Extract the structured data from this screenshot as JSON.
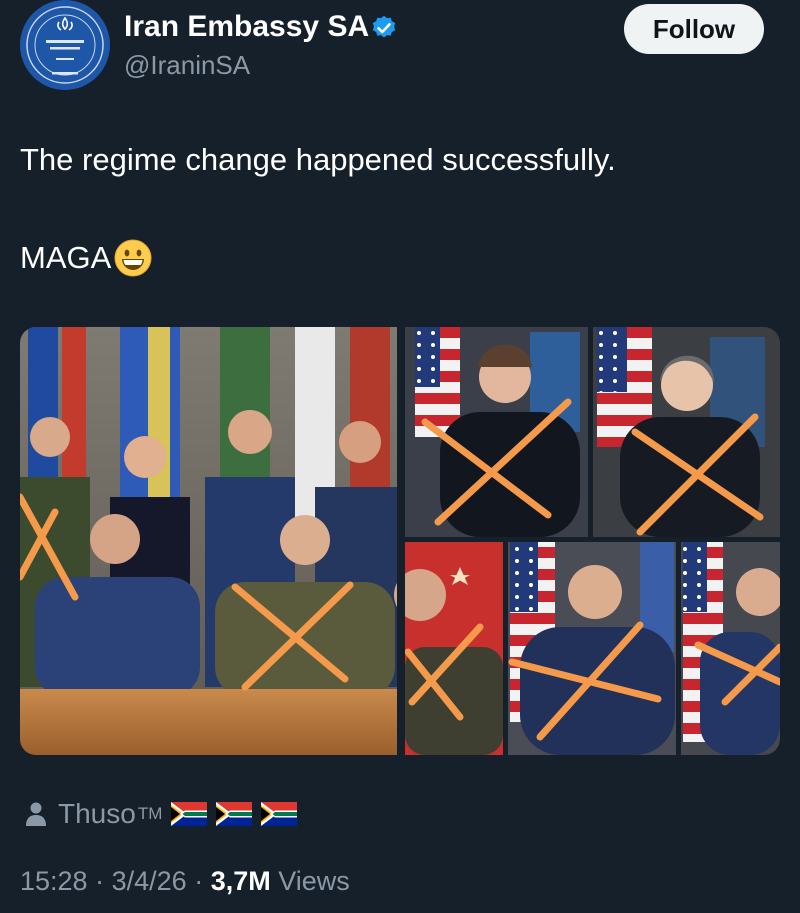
{
  "author": {
    "name": "Iran Embassy SA",
    "handle": "@IraninSA",
    "verified": true,
    "avatar_icon": "embassy-seal-icon"
  },
  "follow_label": "Follow",
  "tweet": {
    "line1": "The regime change happened successfully.",
    "line2": "MAGA",
    "emoji": "grinning-face-emoji"
  },
  "media": {
    "image_count": 6,
    "overlay_mark": "orange-x"
  },
  "attribution": {
    "name": "Thuso",
    "trademark": "TM",
    "flags": [
      "south-africa-flag",
      "south-africa-flag",
      "south-africa-flag"
    ]
  },
  "meta": {
    "time": "15:28",
    "date": "3/4/26",
    "separator": "·",
    "views_count": "3,7M",
    "views_label": "Views"
  },
  "colors": {
    "background": "#15202b",
    "secondary_text": "#8b98a5",
    "verified_blue": "#1d9bf0",
    "x_mark_orange": "#f59a4a"
  }
}
